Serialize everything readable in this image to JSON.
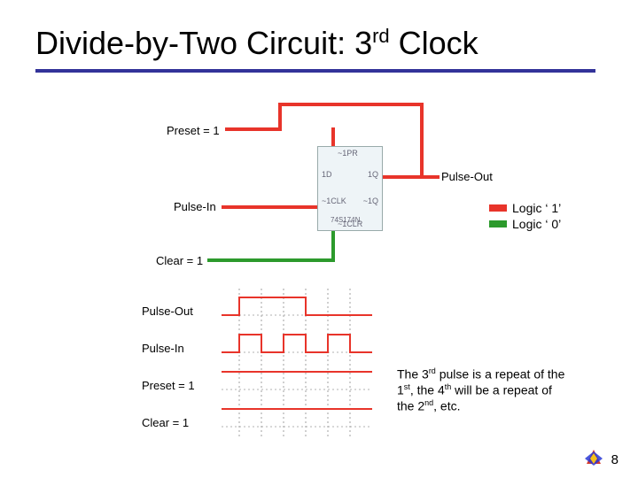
{
  "title_prefix": "Divide-by-Two Circuit: 3",
  "title_suffix": " Clock",
  "title_super": "rd",
  "schematic": {
    "preset_label": "Preset = 1",
    "pulse_in_label": "Pulse-In",
    "clear_label": "Clear = 1",
    "pulse_out_label": "Pulse-Out",
    "ff_pins": {
      "pr": "~1PR",
      "d": "1D",
      "q": "1Q",
      "ck": "~1CLK",
      "qn": "~1Q",
      "cl": "~1CLR",
      "part": "74S174N"
    }
  },
  "legend": {
    "logic1": "Logic ‘ 1’",
    "logic0": "Logic ‘ 0’",
    "color1": "#e8342a",
    "color0": "#2c9a2c"
  },
  "timing": {
    "rows": {
      "pulse_out": "Pulse-Out",
      "pulse_in": "Pulse-In",
      "preset": "Preset = 1",
      "clear": "Clear = 1"
    }
  },
  "explanation_html": "The 3<sup>rd</sup> pulse is a repeat of the 1<sup>st</sup>, the 4<sup>th</sup> will be a repeat of the 2<sup>nd</sup>, etc.",
  "page_number": "8",
  "chart_data": {
    "type": "timing-diagram",
    "time_axis": {
      "start": 0,
      "pulses_shown": 3,
      "gridlines_at_pulse_edges": true
    },
    "signals": [
      {
        "name": "Pulse-Out",
        "pattern": "toggles once per two Pulse-In pulses; high during pulses 1-2, low thereafter in shown window (divide-by-two of Pulse-In)"
      },
      {
        "name": "Pulse-In",
        "pattern": "three equal-width high pulses separated by equal low gaps"
      },
      {
        "name": "Preset = 1",
        "pattern": "constant high (inactive, tied to logic 1)"
      },
      {
        "name": "Clear = 1",
        "pattern": "constant high (inactive, tied to logic 1)"
      }
    ],
    "legend": [
      {
        "label": "Logic '1'",
        "color": "#e8342a"
      },
      {
        "label": "Logic '0'",
        "color": "#2c9a2c"
      }
    ],
    "title": "Divide-by-Two Circuit: 3rd Clock"
  }
}
